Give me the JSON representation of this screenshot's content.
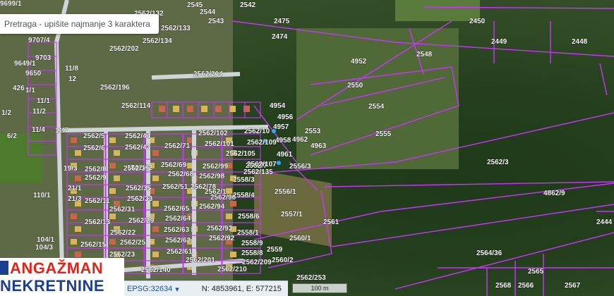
{
  "search": {
    "placeholder": "Pretraga - upišite najmanje 3 karaktera"
  },
  "logo": {
    "line1": "ANGAŽMAN",
    "line2": "NEKRETNINE"
  },
  "status": {
    "projection": "EPSG:32634",
    "coordinates": "N: 4853961, E: 577215"
  },
  "scale": {
    "label": "100 m"
  },
  "colors": {
    "boundary": "#cc33ff",
    "marker": "#2ea3ff"
  },
  "parcels": [
    "9699/1",
    "2545",
    "2544",
    "2542",
    "2562/132",
    "2543",
    "2475",
    "2562/133",
    "2474",
    "2450",
    "2449",
    "2448",
    "9707/4",
    "9703",
    "2562/134",
    "2562/202",
    "2548",
    "9649/1",
    "9650",
    "11/8",
    "2562/204",
    "4952",
    "426",
    "1/1",
    "2562/196",
    "2550",
    "12",
    "11/1",
    "2554",
    "4954",
    "2562/114",
    "4956",
    "11/2",
    "1/2",
    "4957",
    "2553",
    "2555",
    "11/4",
    "11/7",
    "2562/5",
    "2562/44",
    "2562/102",
    "2562/10",
    "6/2",
    "4962",
    "4958",
    "4963",
    "2562/6",
    "2562/43",
    "2562/71",
    "2562/101",
    "2562/105",
    "2562/109",
    "4961",
    "2562/7",
    "2562/42",
    "2562/99",
    "2562/107",
    "19/3",
    "2562/8",
    "2562/39",
    "2562/69",
    "2562/98",
    "2562/135",
    "2556/3",
    "2562/3",
    "21/1",
    "2562/9",
    "2562/68",
    "2558/3",
    "2562/51",
    "2562/78",
    "2556/1",
    "110/1",
    "21/3",
    "2562/35",
    "2562/96",
    "2558/4",
    "4862/9",
    "2562/11",
    "2562/33",
    "2562/65",
    "2562/94",
    "2562/1",
    "2557/1",
    "2562/31",
    "2562/64",
    "2558/6",
    "2561",
    "2444",
    "2562/13",
    "2562/29",
    "2562/63",
    "2562/93",
    "2558/1",
    "104/1",
    "2562/22",
    "2562/62",
    "2562/92",
    "2560/1",
    "104/3",
    "2562/15",
    "2562/25",
    "2562/61",
    "2558/9",
    "2559",
    "2564/36",
    "2562/23",
    "2562/201",
    "2558/8",
    "2562/209",
    "2560/2",
    "2565",
    "2562/140",
    "2562/210",
    "2562/253",
    "2568",
    "2566",
    "2567"
  ]
}
